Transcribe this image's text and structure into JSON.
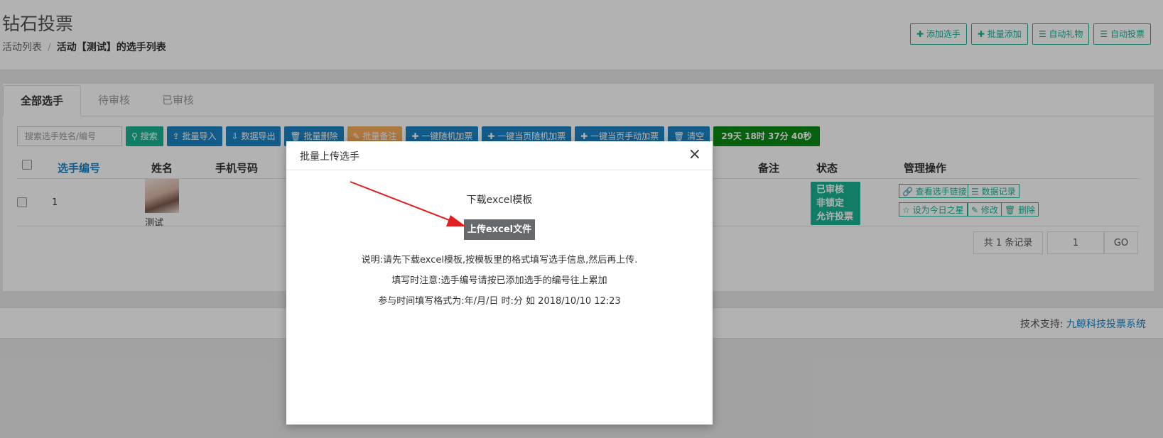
{
  "header": {
    "title": "钻石投票",
    "breadcrumb": {
      "root": "活动列表",
      "separator": "/",
      "current": "活动【测试】的选手列表"
    },
    "actions": [
      "添加选手",
      "批量添加",
      "自动礼物",
      "自动投票"
    ]
  },
  "tabs": [
    "全部选手",
    "待审核",
    "已审核"
  ],
  "toolbar": {
    "search_placeholder": "搜索选手姓名/编号",
    "buttons": [
      "搜索",
      "批量导入",
      "数据导出",
      "批量删除",
      "批量备注",
      "一键随机加票",
      "一键当页随机加票",
      "一键当页手动加票",
      "清空"
    ],
    "countdown": "29天 18时 37分 40秒"
  },
  "table": {
    "headers": {
      "id": "选手编号",
      "name": "姓名",
      "phone": "手机号码",
      "remark": "备注",
      "status": "状态",
      "ops": "管理操作"
    },
    "rows": [
      {
        "id": "1",
        "name": "测试",
        "status": [
          "已审核",
          "非锁定",
          "允许投票"
        ],
        "ops": [
          "查看选手链接",
          "数据记录",
          "设为今日之星",
          "修改",
          "删除"
        ]
      }
    ]
  },
  "pagination": {
    "total": "共 1 条记录",
    "page": "1",
    "go": "GO"
  },
  "footer": {
    "label": "技术支持:",
    "link": "九鲸科技投票系统"
  },
  "modal": {
    "title": "批量上传选手",
    "close": "×",
    "download": "下载excel模板",
    "upload": "上传excel文件",
    "notes": [
      "说明:请先下载excel模板,按模板里的格式填写选手信息,然后再上传.",
      "填写时注意:选手编号请按已添加选手的编号往上累加",
      "参与时间填写格式为:年/月/日 时:分 如 2018/10/10 12:23"
    ]
  },
  "colors": {
    "primary": "#1ab394",
    "info": "#1c84c6",
    "warning": "#f8ac59",
    "countdown": "#0b8a14",
    "arrow": "#e02020"
  }
}
